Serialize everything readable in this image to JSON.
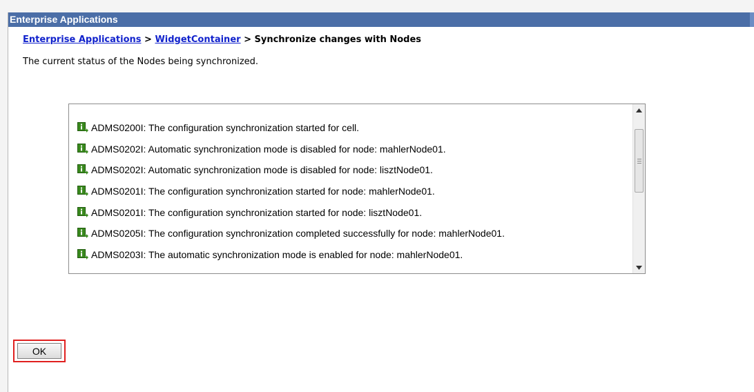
{
  "window": {
    "title": "Enterprise Applications"
  },
  "breadcrumb": {
    "link1": "Enterprise Applications",
    "separator1": " > ",
    "link2": "WidgetContainer",
    "separator2": " > ",
    "current": "Synchronize changes with Nodes"
  },
  "description": "The current status of the Nodes being synchronized.",
  "messages": [
    {
      "icon": "info-icon",
      "text": "ADMS0200I: The configuration synchronization started for cell."
    },
    {
      "icon": "info-icon",
      "text": "ADMS0202I: Automatic synchronization mode is disabled for node: mahlerNode01."
    },
    {
      "icon": "info-icon",
      "text": "ADMS0202I: Automatic synchronization mode is disabled for node: lisztNode01."
    },
    {
      "icon": "info-icon",
      "text": "ADMS0201I: The configuration synchronization started for node: mahlerNode01."
    },
    {
      "icon": "info-icon",
      "text": "ADMS0201I: The configuration synchronization started for node: lisztNode01."
    },
    {
      "icon": "info-icon",
      "text": "ADMS0205I: The configuration synchronization completed successfully for node: mahlerNode01."
    },
    {
      "icon": "info-icon",
      "text": "ADMS0203I: The automatic synchronization mode is enabled for node: mahlerNode01."
    }
  ],
  "ok_label": "OK",
  "colors": {
    "titlebar": "#4b6ea7",
    "link": "#1122cc",
    "highlight": "#e0201f",
    "info_icon": "#3a8a1e"
  }
}
